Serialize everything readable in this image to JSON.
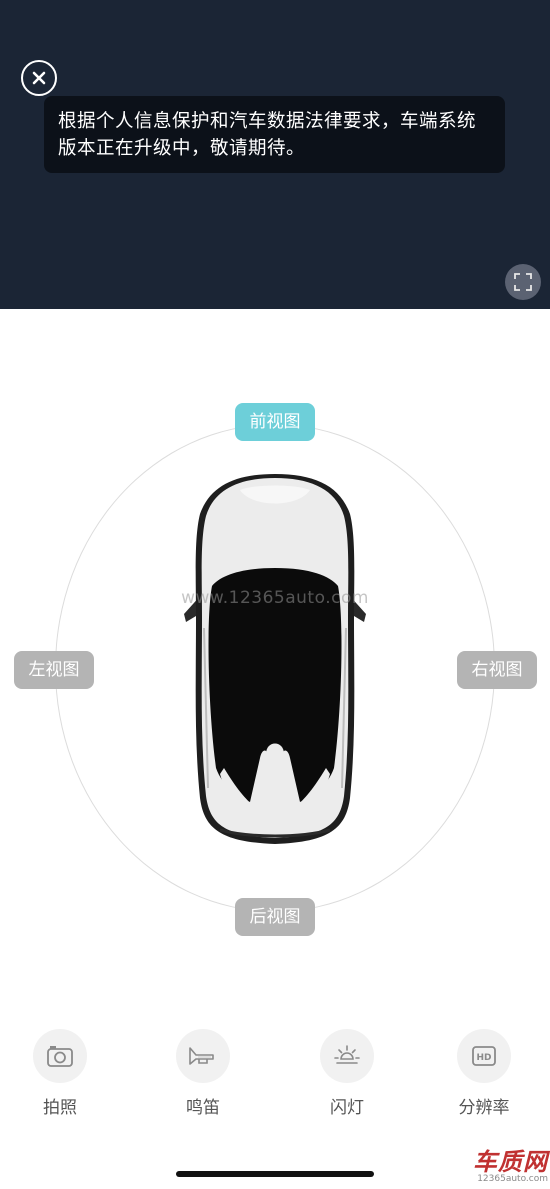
{
  "camera": {
    "notice_text": "根据个人信息保护和汽车数据法律要求，车端系统版本正在升级中，敬请期待。"
  },
  "views": {
    "front": "前视图",
    "left": "左视图",
    "right": "右视图",
    "rear": "后视图",
    "active": "front"
  },
  "watermark": "www.12365auto.com",
  "actions": [
    {
      "label": "拍照",
      "icon": "camera-icon"
    },
    {
      "label": "鸣笛",
      "icon": "horn-icon"
    },
    {
      "label": "闪灯",
      "icon": "light-icon"
    },
    {
      "label": "分辨率",
      "icon": "hd-icon"
    }
  ],
  "hd_badge": "HD",
  "corner_logo": {
    "main": "车质网",
    "sub": "12365auto.com"
  },
  "colors": {
    "panel_bg": "#1b2535",
    "active_pill": "#6dcfd9",
    "inactive_pill": "#b4b4b4"
  }
}
